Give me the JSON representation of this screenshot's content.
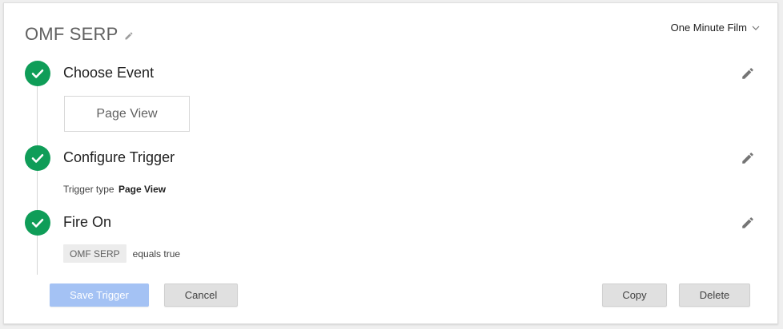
{
  "header": {
    "title": "OMF SERP",
    "account": "One Minute Film"
  },
  "steps": [
    {
      "title": "Choose Event"
    },
    {
      "title": "Configure Trigger"
    },
    {
      "title": "Fire On"
    }
  ],
  "event": {
    "selected": "Page View"
  },
  "trigger": {
    "type_label": "Trigger type",
    "type_value": "Page View"
  },
  "fire_on": {
    "variable": "OMF SERP",
    "condition": "equals true"
  },
  "buttons": {
    "save": "Save Trigger",
    "cancel": "Cancel",
    "copy": "Copy",
    "delete": "Delete"
  },
  "colors": {
    "check": "#0f9d58",
    "save_disabled": "#a4c2f4"
  },
  "icons": {
    "step_status": "check-circle-icon",
    "edit": "pencil-icon",
    "dropdown": "chevron-down-icon"
  }
}
